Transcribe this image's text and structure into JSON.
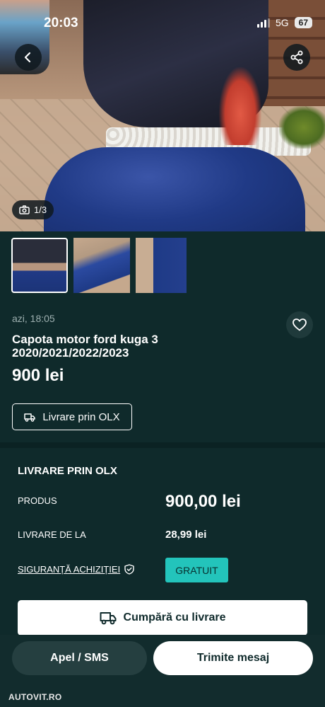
{
  "status_bar": {
    "time": "20:03",
    "network": "5G",
    "battery": "67"
  },
  "gallery": {
    "counter": "1/3",
    "thumbnail_count": 3
  },
  "listing": {
    "posted": "azi, 18:05",
    "title": "Capota motor ford kuga 3 2020/2021/2022/2023",
    "price": "900 lei",
    "delivery_chip": "Livrare prin OLX"
  },
  "delivery": {
    "section_title": "LIVRARE PRIN OLX",
    "product_label": "PRODUS",
    "product_value": "900,00 lei",
    "shipping_label": "LIVRARE DE LA",
    "shipping_value": "28,99 lei",
    "safety_label": "SIGURANȚĂ ACHIZIȚIEI",
    "safety_value": "GRATUIT",
    "buy_button": "Cumpără cu livrare"
  },
  "actions": {
    "call": "Apel / SMS",
    "message": "Trimite mesaj"
  },
  "watermark": "AUTOVIT.RO",
  "colors": {
    "background": "#0f2a2b",
    "accent": "#23c4bb"
  },
  "icons": [
    "back-arrow-icon",
    "share-icon",
    "camera-icon",
    "heart-icon",
    "truck-icon",
    "shield-check-icon"
  ]
}
